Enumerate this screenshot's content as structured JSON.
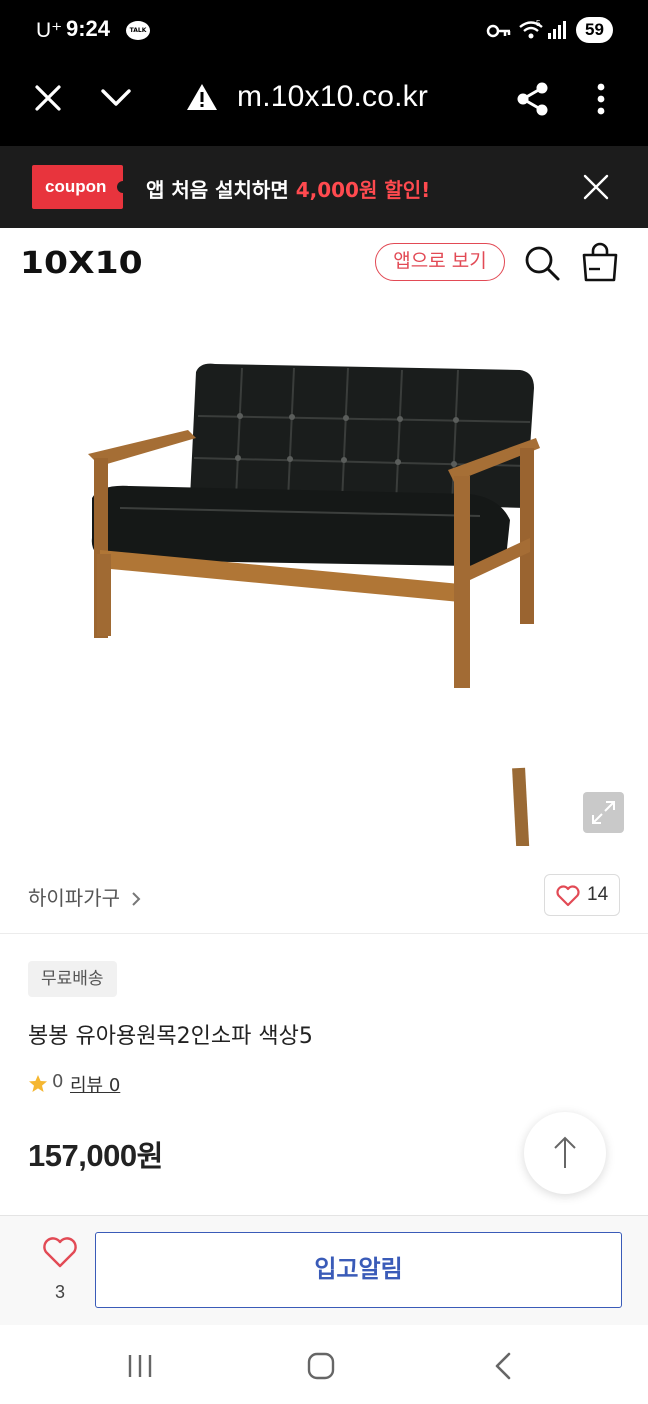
{
  "status_bar": {
    "carrier": "U⁺",
    "time": "9:24",
    "talk_badge": "TALK",
    "battery": "59",
    "icons": [
      "kakaotalk-icon",
      "key-icon",
      "wifi-icon",
      "signal-icon",
      "battery-icon"
    ]
  },
  "browser": {
    "url": "m.10x10.co.kr",
    "icons": [
      "close-icon",
      "chevron-down-icon",
      "warning-icon",
      "share-icon",
      "more-vert-icon"
    ]
  },
  "coupon_banner": {
    "tag": "coupon",
    "text_prefix": "앱 처음 설치하면 ",
    "text_highlight": "4,000원 할인!",
    "accent_color": "#e8343d"
  },
  "header": {
    "logo": "10X10",
    "app_view_button": "앱으로 보기",
    "icons": [
      "search-icon",
      "shopping-bag-icon"
    ]
  },
  "product": {
    "image_alt": "sofa-image",
    "brand": "하이파가구",
    "wish_count": "14",
    "shipping_badge": "무료배송",
    "title": "봉봉 유아용원목2인소파 색상5",
    "rating": "0",
    "review_label": "리뷰 0",
    "price": "157,000",
    "price_unit": "원"
  },
  "action_bar": {
    "like_count": "3",
    "restock_button": "입고알림",
    "button_color": "#3a5bb8"
  }
}
